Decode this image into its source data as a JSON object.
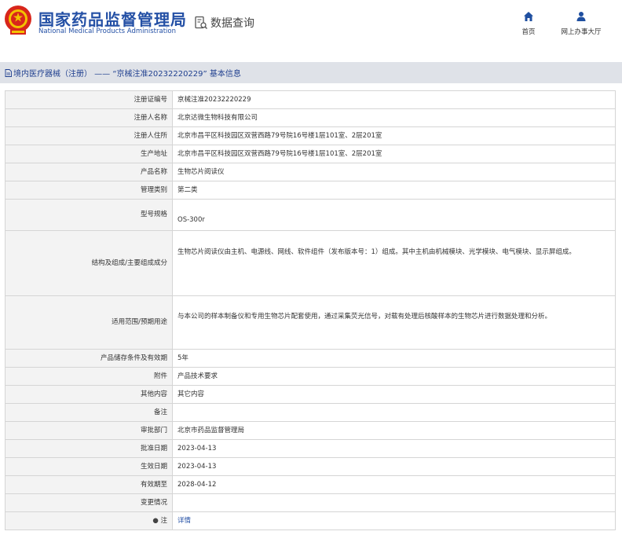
{
  "header": {
    "brand_cn": "国家药品监督管理局",
    "brand_en": "National Medical Products Administration",
    "query_label": "数据查询",
    "nav": [
      {
        "label": "首页",
        "icon": "home-icon"
      },
      {
        "label": "网上办事大厅",
        "icon": "user-icon"
      }
    ]
  },
  "title_bar": {
    "text": "境内医疗器械（注册） —— “京械注准20232220229” 基本信息"
  },
  "rows": [
    {
      "label": "注册证编号",
      "value": "京械注准20232220229"
    },
    {
      "label": "注册人名称",
      "value": "北京达微生物科技有限公司"
    },
    {
      "label": "注册人住所",
      "value": "北京市昌平区科技园区双营西路79号院16号楼1层101室、2层201室"
    },
    {
      "label": "生产地址",
      "value": "北京市昌平区科技园区双营西路79号院16号楼1层101室、2层201室"
    },
    {
      "label": "产品名称",
      "value": "生物芯片阅读仪"
    },
    {
      "label": "管理类别",
      "value": "第二类"
    },
    {
      "label": "型号规格",
      "value": "OS-300r"
    },
    {
      "label": "结构及组成/主要组成成分",
      "value": "生物芯片阅读仪由主机、电源线、网线、软件组件（发布版本号：1）组成。其中主机由机械模块、光学模块、电气模块、显示屏组成。"
    },
    {
      "label": "适用范围/预期用途",
      "value": "与本公司的样本制备仪和专用生物芯片配套使用，通过采集荧光信号，对载有处理后核酸样本的生物芯片进行数据处理和分析。"
    },
    {
      "label": "产品储存条件及有效期",
      "value": "5年"
    },
    {
      "label": "附件",
      "value": "产品技术要求"
    },
    {
      "label": "其他内容",
      "value": "其它内容"
    },
    {
      "label": "备注",
      "value": ""
    },
    {
      "label": "审批部门",
      "value": "北京市药品监督管理局"
    },
    {
      "label": "批准日期",
      "value": "2023-04-13"
    },
    {
      "label": "生效日期",
      "value": "2023-04-13"
    },
    {
      "label": "有效期至",
      "value": "2028-04-12"
    },
    {
      "label": "变更情况",
      "value": ""
    },
    {
      "label": "注",
      "value": "详情"
    }
  ],
  "colors": {
    "brand_blue": "#2450a5",
    "emblem_red": "#d8261b",
    "emblem_gold": "#f2c200",
    "title_bar_bg": "#dfe2e8",
    "label_bg": "#f3f3f3",
    "link_blue": "#2450a5"
  }
}
